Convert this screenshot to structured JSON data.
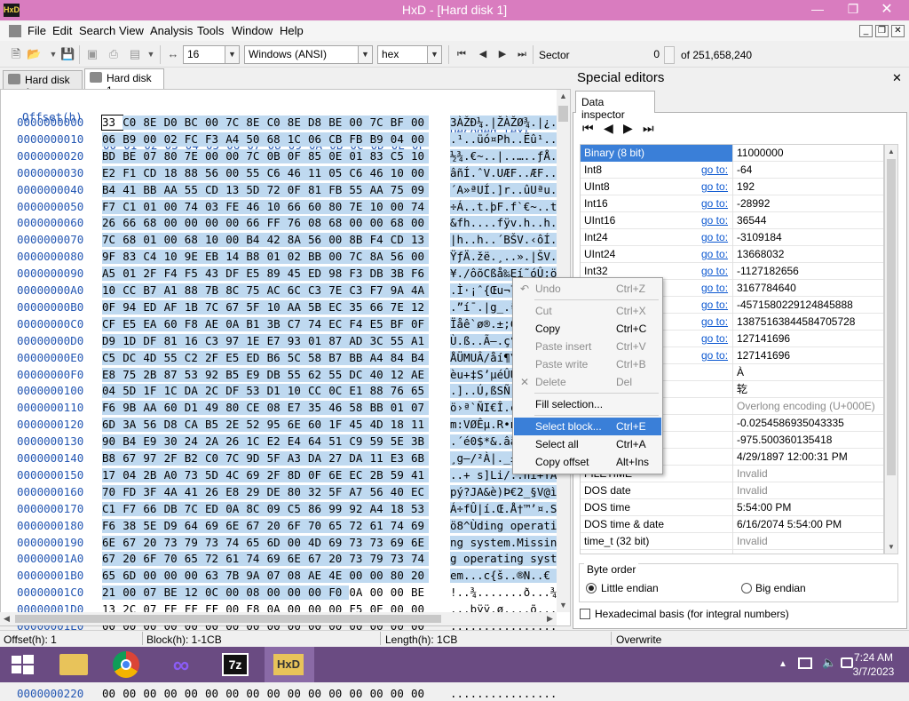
{
  "window": {
    "title": "HxD - [Hard disk 1]",
    "app_icon": "HxD"
  },
  "menu": [
    "File",
    "Edit",
    "Search",
    "View",
    "Analysis",
    "Tools",
    "Window",
    "Help"
  ],
  "toolbar": {
    "bytes_per_row": "16",
    "charset": "Windows (ANSI)",
    "display": "hex",
    "sector_label": "Sector",
    "sector_value": "0",
    "sector_total": "of 251,658,240"
  },
  "tabs": [
    "Hard disk 1",
    "Hard disk 1"
  ],
  "hex": {
    "offset_header": "Offset(h)",
    "columns": [
      "00",
      "01",
      "02",
      "03",
      "04",
      "05",
      "06",
      "07",
      "08",
      "09",
      "0A",
      "0B",
      "0C",
      "0D",
      "0E",
      "0F"
    ],
    "decoded_header": "Decoded text",
    "rows": [
      {
        "offset": "0000000000",
        "bytes": [
          "33",
          "C0",
          "8E",
          "D0",
          "BC",
          "00",
          "7C",
          "8E",
          "C0",
          "8E",
          "D8",
          "BE",
          "00",
          "7C",
          "BF",
          "00"
        ],
        "text": "3ÀŽÐ¼.|ŽÀŽØ¾.|¿."
      },
      {
        "offset": "0000000010",
        "bytes": [
          "06",
          "B9",
          "00",
          "02",
          "FC",
          "F3",
          "A4",
          "50",
          "68",
          "1C",
          "06",
          "CB",
          "FB",
          "B9",
          "04",
          "00"
        ],
        "text": ".¹..üó¤Ph..Ëû¹.."
      },
      {
        "offset": "0000000020",
        "bytes": [
          "BD",
          "BE",
          "07",
          "80",
          "7E",
          "00",
          "00",
          "7C",
          "0B",
          "0F",
          "85",
          "0E",
          "01",
          "83",
          "C5",
          "10"
        ],
        "text": "½¾.€~..|..…..ƒÅ."
      },
      {
        "offset": "0000000030",
        "bytes": [
          "E2",
          "F1",
          "CD",
          "18",
          "88",
          "56",
          "00",
          "55",
          "C6",
          "46",
          "11",
          "05",
          "C6",
          "46",
          "10",
          "00"
        ],
        "text": "âñÍ.ˆV.UÆF..ÆF.."
      },
      {
        "offset": "0000000040",
        "bytes": [
          "B4",
          "41",
          "BB",
          "AA",
          "55",
          "CD",
          "13",
          "5D",
          "72",
          "0F",
          "81",
          "FB",
          "55",
          "AA",
          "75",
          "09"
        ],
        "text": "´A»ªUÍ.]r..ûUªu."
      },
      {
        "offset": "0000000050",
        "bytes": [
          "F7",
          "C1",
          "01",
          "00",
          "74",
          "03",
          "FE",
          "46",
          "10",
          "66",
          "60",
          "80",
          "7E",
          "10",
          "00",
          "74"
        ],
        "text": "÷Á..t.þF.f`€~..t"
      },
      {
        "offset": "0000000060",
        "bytes": [
          "26",
          "66",
          "68",
          "00",
          "00",
          "00",
          "00",
          "66",
          "FF",
          "76",
          "08",
          "68",
          "00",
          "00",
          "68",
          "00"
        ],
        "text": "&fh....fÿv.h..h."
      },
      {
        "offset": "0000000070",
        "bytes": [
          "7C",
          "68",
          "01",
          "00",
          "68",
          "10",
          "00",
          "B4",
          "42",
          "8A",
          "56",
          "00",
          "8B",
          "F4",
          "CD",
          "13"
        ],
        "text": "|h..h..´BŠV.‹ôÍ."
      },
      {
        "offset": "0000000080",
        "bytes": [
          "9F",
          "83",
          "C4",
          "10",
          "9E",
          "EB",
          "14",
          "B8",
          "01",
          "02",
          "BB",
          "00",
          "7C",
          "8A",
          "56",
          "00"
        ],
        "text": "ŸƒÄ.žë.¸..».|ŠV."
      },
      {
        "offset": "0000000090",
        "bytes": [
          "A5",
          "01",
          "2F",
          "F4",
          "F5",
          "43",
          "DF",
          "E5",
          "89",
          "45",
          "ED",
          "98",
          "F3",
          "DB",
          "3B",
          "F6"
        ],
        "text": "¥./ôõCßå‰Eí˜óÛ;ö"
      },
      {
        "offset": "00000000A0",
        "bytes": [
          "10",
          "CC",
          "B7",
          "A1",
          "88",
          "7B",
          "8C",
          "75",
          "AC",
          "6C",
          "C3",
          "7E",
          "C3",
          "F7",
          "9A",
          "4A"
        ],
        "text": ".Ì·¡ˆ{Œu¬lÃ~Ã÷šJ"
      },
      {
        "offset": "00000000B0",
        "bytes": [
          "0F",
          "94",
          "ED",
          "AF",
          "1B",
          "7C",
          "67",
          "5F",
          "10",
          "AA",
          "5B",
          "EC",
          "35",
          "66",
          "7E",
          "12"
        ],
        "text": ".”í¯.|g_.ª[ì5f~."
      },
      {
        "offset": "00000000C0",
        "bytes": [
          "CF",
          "E5",
          "EA",
          "60",
          "F8",
          "AE",
          "0A",
          "B1",
          "3B",
          "C7",
          "74",
          "EC",
          "F4",
          "E5",
          "BF",
          "0F"
        ],
        "text": "Ïåê`ø®.±;Çtìôå¿."
      },
      {
        "offset": "00000000D0",
        "bytes": [
          "D9",
          "1D",
          "DF",
          "81",
          "16",
          "C3",
          "97",
          "1E",
          "E7",
          "93",
          "01",
          "87",
          "AD",
          "3C",
          "55",
          "A1"
        ],
        "text": "Ù.ß..Ã—.ç“.‡.<U¡"
      },
      {
        "offset": "00000000E0",
        "bytes": [
          "C5",
          "DC",
          "4D",
          "55",
          "C2",
          "2F",
          "E5",
          "ED",
          "B6",
          "5C",
          "58",
          "B7",
          "BB",
          "A4",
          "84",
          "B4"
        ],
        "text": "ÅÜMUÂ/åí¶\\X·»¤„´"
      },
      {
        "offset": "00000000F0",
        "bytes": [
          "E8",
          "75",
          "2B",
          "87",
          "53",
          "92",
          "B5",
          "E9",
          "DB",
          "55",
          "62",
          "55",
          "DC",
          "40",
          "12",
          "AE"
        ],
        "text": "èu+‡S’µéÛUbUÜ@.®"
      },
      {
        "offset": "0000000100",
        "bytes": [
          "04",
          "5D",
          "1F",
          "1C",
          "DA",
          "2C",
          "DF",
          "53",
          "D1",
          "10",
          "CC",
          "0C",
          "E1",
          "88",
          "76",
          "65"
        ],
        "text": ".]..Ú,ßSÑ.Ì.áˆve"
      },
      {
        "offset": "0000000110",
        "bytes": [
          "F6",
          "9B",
          "AA",
          "60",
          "D1",
          "49",
          "80",
          "CE",
          "08",
          "E7",
          "35",
          "46",
          "58",
          "BB",
          "01",
          "07"
        ],
        "text": "ö›ª`ÑI€Î.ç5FX».."
      },
      {
        "offset": "0000000120",
        "bytes": [
          "6D",
          "3A",
          "56",
          "D8",
          "CA",
          "B5",
          "2E",
          "52",
          "95",
          "6E",
          "60",
          "1F",
          "45",
          "4D",
          "18",
          "11"
        ],
        "text": "m:VØÊµ.R•n`.EM.."
      },
      {
        "offset": "0000000130",
        "bytes": [
          "90",
          "B4",
          "E9",
          "30",
          "24",
          "2A",
          "26",
          "1C",
          "E2",
          "E4",
          "64",
          "51",
          "C9",
          "59",
          "5E",
          "3B"
        ],
        "text": ".´é0$*&.âädQÉY^;"
      },
      {
        "offset": "0000000140",
        "bytes": [
          "B8",
          "67",
          "97",
          "2F",
          "B2",
          "C0",
          "7C",
          "9D",
          "5F",
          "A3",
          "DA",
          "27",
          "DA",
          "11",
          "E3",
          "6B"
        ],
        "text": "¸g—/²À|._£Ú'Ú.ãk"
      },
      {
        "offset": "0000000150",
        "bytes": [
          "17",
          "04",
          "2B",
          "A0",
          "73",
          "5D",
          "4C",
          "69",
          "2F",
          "8D",
          "0F",
          "6E",
          "EC",
          "2B",
          "59",
          "41"
        ],
        "text": "..+ s]Li/..nì+YA"
      },
      {
        "offset": "0000000160",
        "bytes": [
          "70",
          "FD",
          "3F",
          "4A",
          "41",
          "26",
          "E8",
          "29",
          "DE",
          "80",
          "32",
          "5F",
          "A7",
          "56",
          "40",
          "EC"
        ],
        "text": "pý?JA&è)Þ€2_§V@ì"
      },
      {
        "offset": "0000000170",
        "bytes": [
          "C1",
          "F7",
          "66",
          "DB",
          "7C",
          "ED",
          "0A",
          "8C",
          "09",
          "C5",
          "86",
          "99",
          "92",
          "A4",
          "18",
          "53"
        ],
        "text": "Á÷fÛ|í.Œ.Å†™’¤.S"
      },
      {
        "offset": "0000000180",
        "bytes": [
          "F6",
          "38",
          "5E",
          "D9",
          "64",
          "69",
          "6E",
          "67",
          "20",
          "6F",
          "70",
          "65",
          "72",
          "61",
          "74",
          "69"
        ],
        "text": "ö8^Ùding operati"
      },
      {
        "offset": "0000000190",
        "bytes": [
          "6E",
          "67",
          "20",
          "73",
          "79",
          "73",
          "74",
          "65",
          "6D",
          "00",
          "4D",
          "69",
          "73",
          "73",
          "69",
          "6E"
        ],
        "text": "ng system.Missin"
      },
      {
        "offset": "00000001A0",
        "bytes": [
          "67",
          "20",
          "6F",
          "70",
          "65",
          "72",
          "61",
          "74",
          "69",
          "6E",
          "67",
          "20",
          "73",
          "79",
          "73",
          "74"
        ],
        "text": "g operating syst"
      },
      {
        "offset": "00000001B0",
        "bytes": [
          "65",
          "6D",
          "00",
          "00",
          "00",
          "63",
          "7B",
          "9A",
          "07",
          "08",
          "AE",
          "4E",
          "00",
          "00",
          "80",
          "20"
        ],
        "text": "em...c{š..®N..€ "
      },
      {
        "offset": "00000001C0",
        "bytes": [
          "21",
          "00",
          "07",
          "BE",
          "12",
          "0C",
          "00",
          "08",
          "00",
          "00",
          "00",
          "F0",
          "0A",
          "00",
          "00",
          "BE"
        ],
        "text": "!..¾.......ð...¾"
      },
      {
        "offset": "00000001D0",
        "bytes": [
          "13",
          "2C",
          "07",
          "FE",
          "FF",
          "FF",
          "00",
          "F8",
          "0A",
          "00",
          "00",
          "00",
          "F5",
          "0E",
          "00",
          "00"
        ],
        "text": ".,.þÿÿ.ø....õ..."
      },
      {
        "offset": "00000001E0",
        "bytes": [
          "00",
          "00",
          "00",
          "00",
          "00",
          "00",
          "00",
          "00",
          "00",
          "00",
          "00",
          "00",
          "00",
          "00",
          "00",
          "00"
        ],
        "text": "................"
      },
      {
        "offset": "00000001F0",
        "bytes": [
          "00",
          "00",
          "00",
          "00",
          "00",
          "00",
          "00",
          "00",
          "00",
          "00",
          "00",
          "00",
          "00",
          "00",
          "55",
          "AA"
        ],
        "text": "..............Uª"
      },
      {
        "offset": "0000000200",
        "bytes": [
          "00",
          "00",
          "00",
          "00",
          "00",
          "00",
          "00",
          "00",
          "00",
          "00",
          "00",
          "00",
          "00",
          "00",
          "00",
          "00"
        ],
        "text": "................"
      },
      {
        "offset": "0000000210",
        "bytes": [
          "00",
          "00",
          "00",
          "00",
          "00",
          "00",
          "00",
          "00",
          "00",
          "00",
          "00",
          "00",
          "00",
          "00",
          "00",
          "00"
        ],
        "text": "................"
      },
      {
        "offset": "0000000220",
        "bytes": [
          "00",
          "00",
          "00",
          "00",
          "00",
          "00",
          "00",
          "00",
          "00",
          "00",
          "00",
          "00",
          "00",
          "00",
          "00",
          "00"
        ],
        "text": "................"
      }
    ]
  },
  "special_editors": {
    "title": "Special editors",
    "tab": "Data inspector",
    "rows": [
      {
        "name": "Binary (8 bit)",
        "goto": "",
        "value": "11000000",
        "dim": false
      },
      {
        "name": "Int8",
        "goto": "go to:",
        "value": "-64",
        "dim": false
      },
      {
        "name": "UInt8",
        "goto": "go to:",
        "value": "192",
        "dim": false
      },
      {
        "name": "Int16",
        "goto": "go to:",
        "value": "-28992",
        "dim": false
      },
      {
        "name": "UInt16",
        "goto": "go to:",
        "value": "36544",
        "dim": false
      },
      {
        "name": "Int24",
        "goto": "go to:",
        "value": "-3109184",
        "dim": false
      },
      {
        "name": "UInt24",
        "goto": "go to:",
        "value": "13668032",
        "dim": false
      },
      {
        "name": "Int32",
        "goto": "go to:",
        "value": "-1127182656",
        "dim": false
      },
      {
        "name": "",
        "goto": "go to:",
        "value": "3167784640",
        "dim": false
      },
      {
        "name": "",
        "goto": "go to:",
        "value": "-4571580229124845888",
        "dim": false
      },
      {
        "name": "",
        "goto": "go to:",
        "value": "13875163844584705728",
        "dim": false
      },
      {
        "name": "",
        "goto": "go to:",
        "value": "127141696",
        "dim": false
      },
      {
        "name": "",
        "goto": "go to:",
        "value": "127141696",
        "dim": false
      },
      {
        "name": "_t",
        "goto": "",
        "value": "À",
        "dim": false
      },
      {
        "name": "16_t",
        "goto": "",
        "value": "䢀",
        "dim": false
      },
      {
        "name": "t",
        "goto": "",
        "value": "Overlong encoding (U+000E)",
        "dim": true
      },
      {
        "name": "",
        "goto": "",
        "value": "-0.0254586935043335",
        "dim": false
      },
      {
        "name": "",
        "goto": "",
        "value": "-975.500360135418",
        "dim": false
      },
      {
        "name": "",
        "goto": "",
        "value": "4/29/1897 12:00:31 PM",
        "dim": false
      },
      {
        "name": "FILETIME",
        "goto": "",
        "value": "Invalid",
        "dim": true
      },
      {
        "name": "DOS date",
        "goto": "",
        "value": "Invalid",
        "dim": true
      },
      {
        "name": "DOS time",
        "goto": "",
        "value": "5:54:00 PM",
        "dim": false
      },
      {
        "name": "DOS time & date",
        "goto": "",
        "value": "6/16/2074 5:54:00 PM",
        "dim": false
      },
      {
        "name": "time_t (32 bit)",
        "goto": "",
        "value": "Invalid",
        "dim": true
      },
      {
        "name": "time_t (64 bit)",
        "goto": "",
        "value": "Invalid",
        "dim": true
      }
    ],
    "byte_order": {
      "title": "Byte order",
      "little": "Little endian",
      "big": "Big endian"
    },
    "hex_basis": "Hexadecimal basis (for integral numbers)"
  },
  "context_menu": [
    {
      "label": "Undo",
      "key": "Ctrl+Z",
      "enabled": false,
      "icon": "undo-icon"
    },
    {
      "label": "Cut",
      "key": "Ctrl+X",
      "enabled": false,
      "icon": ""
    },
    {
      "label": "Copy",
      "key": "Ctrl+C",
      "enabled": true,
      "icon": "copy-icon"
    },
    {
      "label": "Paste insert",
      "key": "Ctrl+V",
      "enabled": false,
      "icon": ""
    },
    {
      "label": "Paste write",
      "key": "Ctrl+B",
      "enabled": false,
      "icon": ""
    },
    {
      "label": "Delete",
      "key": "Del",
      "enabled": false,
      "icon": "delete-icon"
    },
    {
      "label": "Fill selection...",
      "key": "",
      "enabled": true,
      "icon": ""
    },
    {
      "label": "Select block...",
      "key": "Ctrl+E",
      "enabled": true,
      "icon": ""
    },
    {
      "label": "Select all",
      "key": "Ctrl+A",
      "enabled": true,
      "icon": ""
    },
    {
      "label": "Copy offset",
      "key": "Alt+Ins",
      "enabled": true,
      "icon": ""
    }
  ],
  "statusbar": {
    "offset": "Offset(h): 1",
    "block": "Block(h): 1-1CB",
    "length": "Length(h): 1CB",
    "mode": "Overwrite"
  },
  "taskbar": {
    "time": "7:24 AM",
    "date": "3/7/2023",
    "apps": [
      "start-icon",
      "file-explorer-icon",
      "chrome-icon",
      "visual-studio-icon",
      "7zip-icon",
      "hxd-icon"
    ]
  }
}
